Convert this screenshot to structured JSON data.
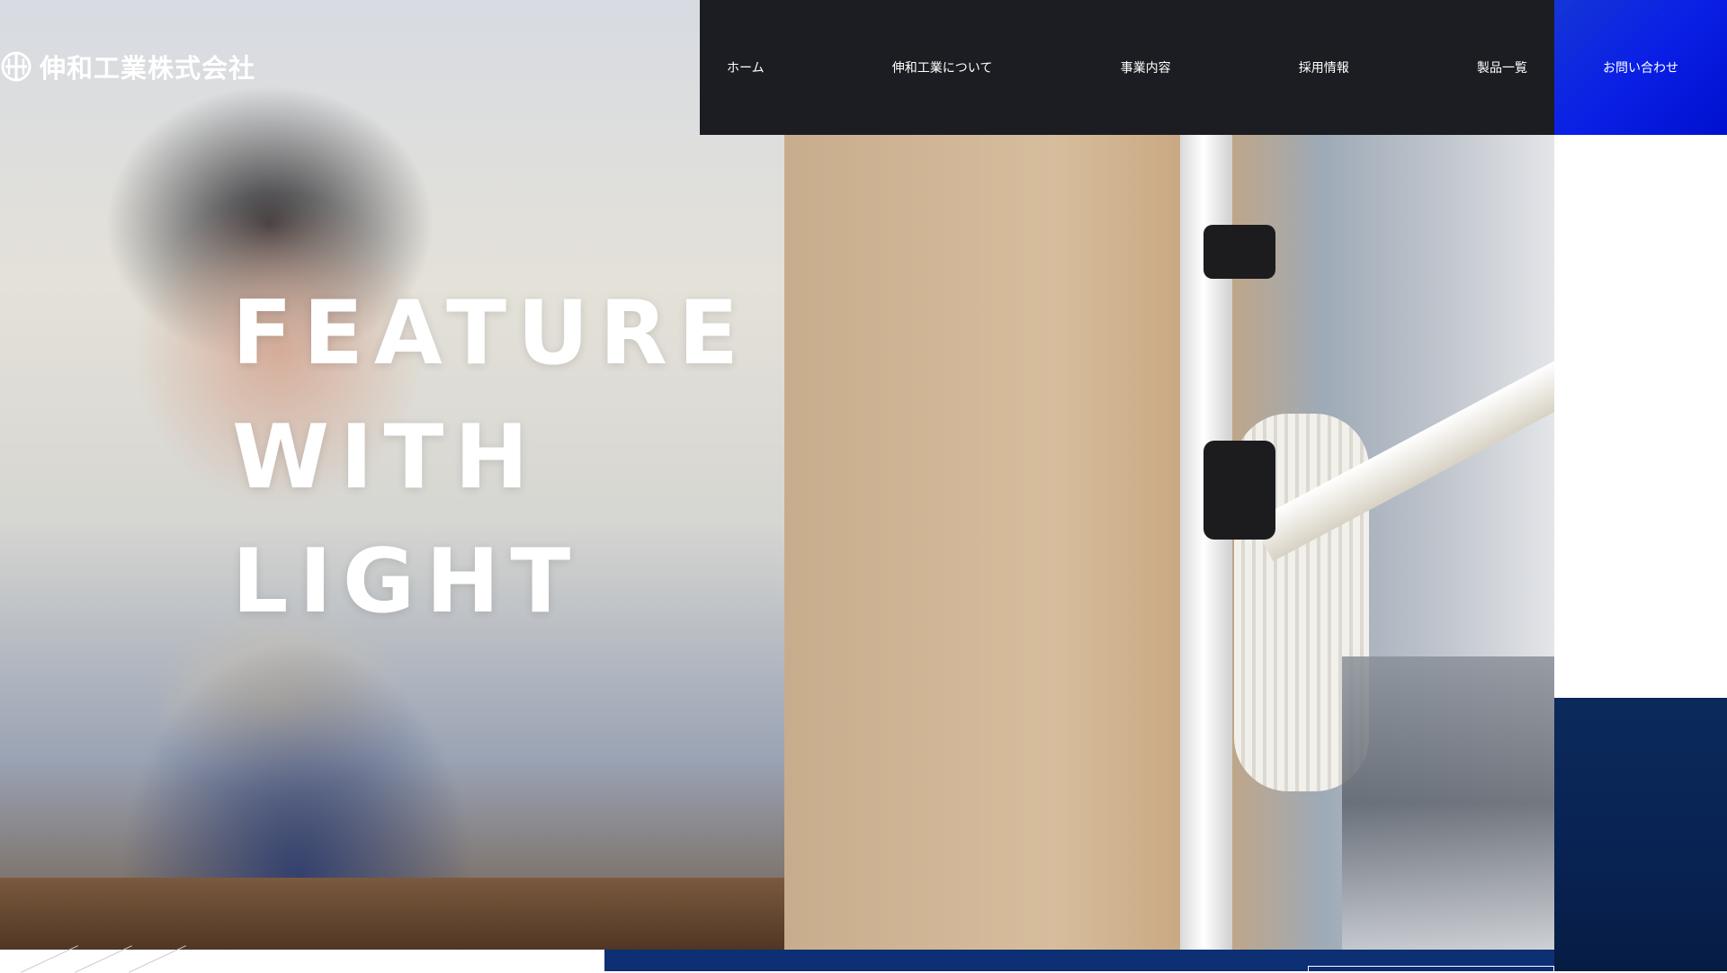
{
  "logo": {
    "text": "伸和工業株式会社",
    "icon": "company-logo-mark"
  },
  "nav": {
    "items": [
      {
        "label": "ホーム"
      },
      {
        "label": "伸和工業について"
      },
      {
        "label": "事業内容"
      },
      {
        "label": "採用情報"
      },
      {
        "label": "製品一覧"
      }
    ],
    "contact_label": "お問い合わせ"
  },
  "hero": {
    "title_lines": [
      "FEATURE",
      "WITH",
      "LIGHT"
    ]
  },
  "colors": {
    "nav_background": "#1c1d22",
    "contact_accent": "#0a1fe6",
    "navy": "#0b2a5c",
    "bottom_strip": "#0d2f73"
  }
}
